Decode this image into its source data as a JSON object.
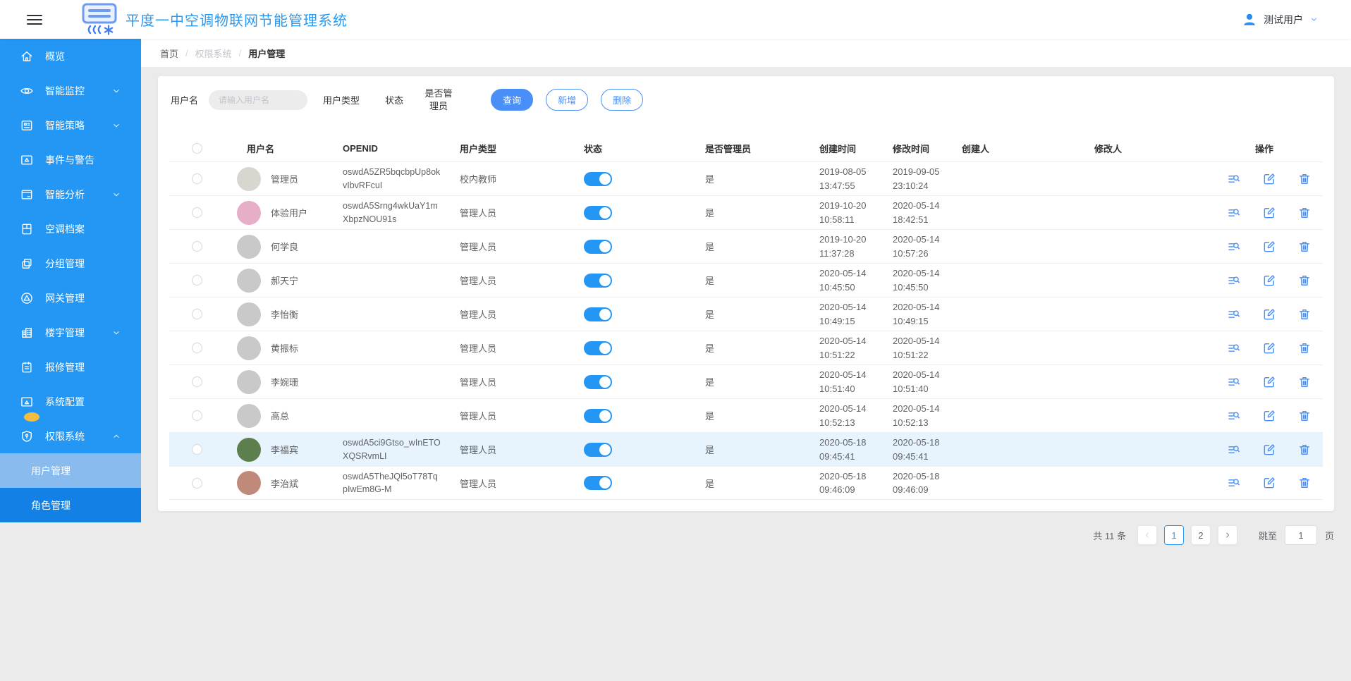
{
  "header": {
    "title": "平度一中空调物联网节能管理系统",
    "user_name": "测试用户"
  },
  "sidebar": {
    "items": [
      {
        "id": "overview",
        "label": "概览",
        "icon": "home-icon"
      },
      {
        "id": "smart-monitor",
        "label": "智能监控",
        "icon": "eye-icon",
        "chevron": "down"
      },
      {
        "id": "smart-strategy",
        "label": "智能策略",
        "icon": "strategy-icon",
        "chevron": "down"
      },
      {
        "id": "events-alerts",
        "label": "事件与警告",
        "icon": "alert-icon"
      },
      {
        "id": "smart-analysis",
        "label": "智能分析",
        "icon": "analysis-icon",
        "chevron": "down"
      },
      {
        "id": "ac-archive",
        "label": "空调档案",
        "icon": "archive-icon"
      },
      {
        "id": "group-mgmt",
        "label": "分组管理",
        "icon": "group-icon"
      },
      {
        "id": "gateway-mgmt",
        "label": "网关管理",
        "icon": "gateway-icon"
      },
      {
        "id": "building-mgmt",
        "label": "楼宇管理",
        "icon": "building-icon",
        "chevron": "down"
      },
      {
        "id": "repair-mgmt",
        "label": "报修管理",
        "icon": "repair-icon"
      },
      {
        "id": "system-config",
        "label": "系统配置",
        "icon": "config-icon",
        "badge": true
      },
      {
        "id": "permission-system",
        "label": "权限系统",
        "icon": "shield-icon",
        "chevron": "up",
        "expanded": true
      }
    ],
    "submenu": [
      {
        "id": "user-mgmt",
        "label": "用户管理",
        "active": true
      },
      {
        "id": "role-mgmt",
        "label": "角色管理",
        "active": false
      }
    ]
  },
  "breadcrumb": {
    "separator": "/",
    "items": [
      "首页",
      "权限系统",
      "用户管理"
    ]
  },
  "filters": {
    "username_label": "用户名",
    "username_placeholder": "请输入用户名",
    "username_value": "",
    "type_label": "用户类型",
    "status_label": "状态",
    "admin_label": "是否管理员",
    "buttons": {
      "search": "查询",
      "add": "新增",
      "delete": "删除"
    }
  },
  "table": {
    "columns": [
      {
        "id": "username",
        "label": "用户名"
      },
      {
        "id": "openid",
        "label": "OPENID"
      },
      {
        "id": "user-type",
        "label": "用户类型"
      },
      {
        "id": "status",
        "label": "状态"
      },
      {
        "id": "is-admin",
        "label": "是否管理员"
      },
      {
        "id": "created-at",
        "label": "创建时间"
      },
      {
        "id": "modified-at",
        "label": "修改时间"
      },
      {
        "id": "creator",
        "label": "创建人"
      },
      {
        "id": "modifier",
        "label": "修改人"
      },
      {
        "id": "actions",
        "label": "操作"
      }
    ],
    "row_actions": [
      {
        "id": "view-detail",
        "icon": "detail-icon"
      },
      {
        "id": "edit",
        "icon": "edit-icon"
      },
      {
        "id": "delete",
        "icon": "delete-icon"
      }
    ],
    "rows": [
      {
        "name": "管理员",
        "openid": "oswdA5ZR5bqcbpUp8okvIbvRFcuI",
        "type": "校内教师",
        "status_on": true,
        "is_admin": "是",
        "created": "2019-08-05 13:47:55",
        "modified": "2019-09-05 23:10:24",
        "creator": "",
        "modifier": "",
        "avatar_color": "#d8d6cf",
        "highlight": false
      },
      {
        "name": "体验用户",
        "openid": "oswdA5Srng4wkUaY1mXbpzNOU91s",
        "type": "管理人员",
        "status_on": true,
        "is_admin": "是",
        "created": "2019-10-20 10:58:11",
        "modified": "2020-05-14 18:42:51",
        "creator": "",
        "modifier": "",
        "avatar_color": "#e7aec8",
        "highlight": false
      },
      {
        "name": "何学良",
        "openid": "",
        "type": "管理人员",
        "status_on": true,
        "is_admin": "是",
        "created": "2019-10-20 11:37:28",
        "modified": "2020-05-14 10:57:26",
        "creator": "",
        "modifier": "",
        "avatar_color": "#c9c9c9",
        "highlight": false
      },
      {
        "name": "郝天宁",
        "openid": "",
        "type": "管理人员",
        "status_on": true,
        "is_admin": "是",
        "created": "2020-05-14 10:45:50",
        "modified": "2020-05-14 10:45:50",
        "creator": "",
        "modifier": "",
        "avatar_color": "#c9c9c9",
        "highlight": false
      },
      {
        "name": "李怡衡",
        "openid": "",
        "type": "管理人员",
        "status_on": true,
        "is_admin": "是",
        "created": "2020-05-14 10:49:15",
        "modified": "2020-05-14 10:49:15",
        "creator": "",
        "modifier": "",
        "avatar_color": "#c9c9c9",
        "highlight": false
      },
      {
        "name": "黄振标",
        "openid": "",
        "type": "管理人员",
        "status_on": true,
        "is_admin": "是",
        "created": "2020-05-14 10:51:22",
        "modified": "2020-05-14 10:51:22",
        "creator": "",
        "modifier": "",
        "avatar_color": "#c9c9c9",
        "highlight": false
      },
      {
        "name": "李婉珊",
        "openid": "",
        "type": "管理人员",
        "status_on": true,
        "is_admin": "是",
        "created": "2020-05-14 10:51:40",
        "modified": "2020-05-14 10:51:40",
        "creator": "",
        "modifier": "",
        "avatar_color": "#c9c9c9",
        "highlight": false
      },
      {
        "name": "高总",
        "openid": "",
        "type": "管理人员",
        "status_on": true,
        "is_admin": "是",
        "created": "2020-05-14 10:52:13",
        "modified": "2020-05-14 10:52:13",
        "creator": "",
        "modifier": "",
        "avatar_color": "#c9c9c9",
        "highlight": false
      },
      {
        "name": "李福宾",
        "openid": "oswdA5ci9Gtso_wInETOXQSRvmLI",
        "type": "管理人员",
        "status_on": true,
        "is_admin": "是",
        "created": "2020-05-18 09:45:41",
        "modified": "2020-05-18 09:45:41",
        "creator": "",
        "modifier": "",
        "avatar_color": "#5c7f4d",
        "highlight": true
      },
      {
        "name": "李治斌",
        "openid": "oswdA5TheJQl5oT78TqpIwEm8G-M",
        "type": "管理人员",
        "status_on": true,
        "is_admin": "是",
        "created": "2020-05-18 09:46:09",
        "modified": "2020-05-18 09:46:09",
        "creator": "",
        "modifier": "",
        "avatar_color": "#c08a7a",
        "highlight": false
      }
    ]
  },
  "pagination": {
    "total_label": "共 11 条",
    "pages": [
      "1",
      "2"
    ],
    "active_page": "1",
    "jump_label": "跳至",
    "jump_value": "1",
    "jump_suffix": "页"
  },
  "colors": {
    "sidebar_blue": "#2496f3",
    "submenu_dark_blue": "#1280e4",
    "submenu_active_blue": "#8abbef",
    "accent_blue": "#4a8ff7",
    "toggle_on": "#2496f3",
    "badge_yellow": "#f3bd42",
    "row_highlight": "#e7f4fd"
  }
}
